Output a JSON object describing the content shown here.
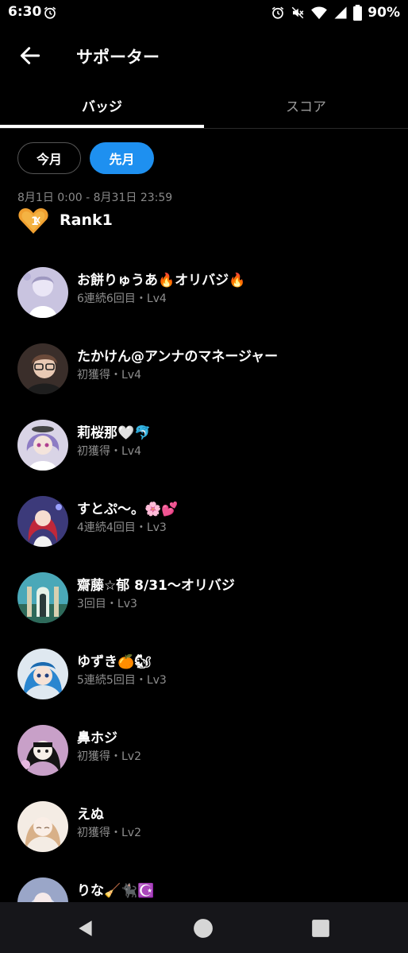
{
  "status": {
    "time": "6:30",
    "battery": "90%"
  },
  "header": {
    "title": "サポーター"
  },
  "tabs": [
    {
      "label": "バッジ",
      "selected": true
    },
    {
      "label": "スコア",
      "selected": false
    }
  ],
  "filters": {
    "this_month": "今月",
    "last_month": "先月",
    "selected": "last_month"
  },
  "period": "8月1日 0:00 - 8月31日 23:59",
  "rank": {
    "label": "Rank1",
    "icon": "heart-badge-icon"
  },
  "colors": {
    "accent": "#1e90f0",
    "background": "#000000",
    "subtext": "#8e8e8e",
    "badge": "#f0a030"
  },
  "supporters": [
    {
      "name": "お餅りゅうあ🔥オリバジ🔥",
      "detail": "6連続6回目・Lv4"
    },
    {
      "name": "たかけん@アンナのマネージャー",
      "detail": "初獲得・Lv4"
    },
    {
      "name": "莉桜那🤍🐬",
      "detail": "初獲得・Lv4"
    },
    {
      "name": "すとぷ〜。🌸💕",
      "detail": "4連続4回目・Lv3"
    },
    {
      "name": "齋藤☆郁 8/31〜オリバジ",
      "detail": "3回目・Lv3"
    },
    {
      "name": "ゆずき🍊🐿",
      "detail": "5連続5回目・Lv3"
    },
    {
      "name": "鼻ホジ",
      "detail": "初獲得・Lv2"
    },
    {
      "name": "えぬ",
      "detail": "初獲得・Lv2"
    },
    {
      "name": "りな🧹🐈‍⬛☪️",
      "detail": ""
    }
  ]
}
